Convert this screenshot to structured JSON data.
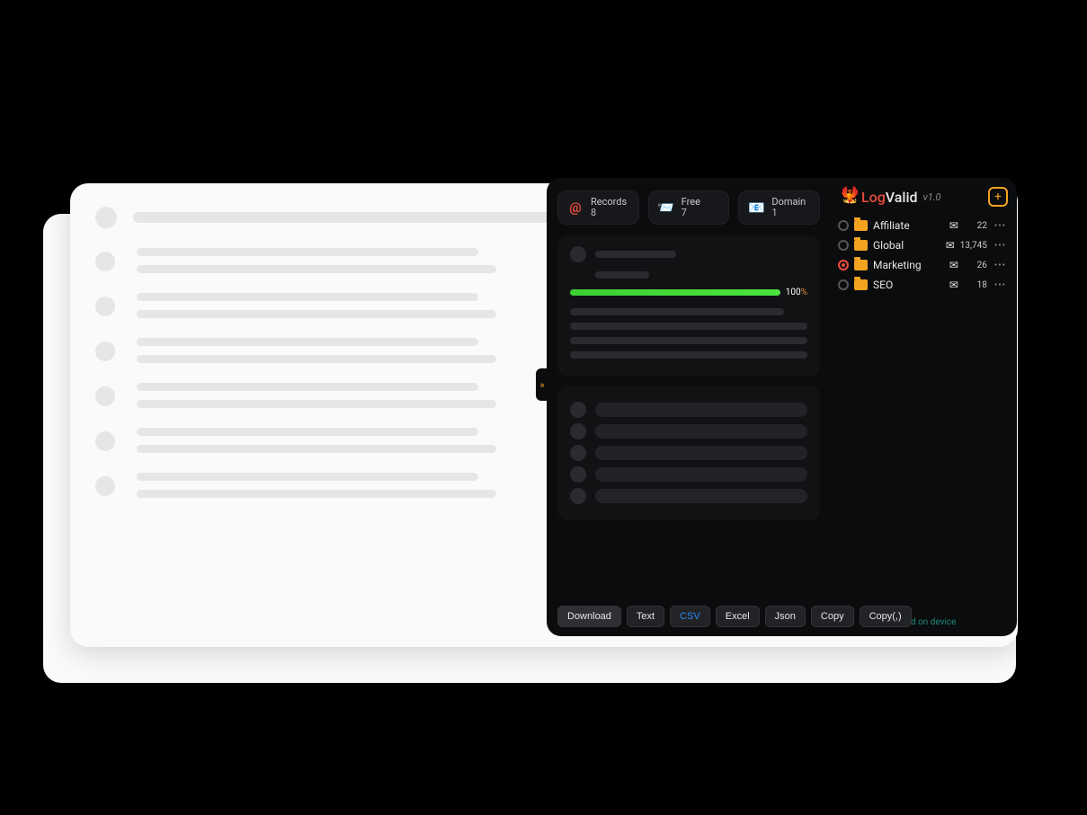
{
  "app": {
    "brand_log": "Log",
    "brand_valid": "Valid",
    "version": "v1.0"
  },
  "stats": {
    "records": {
      "label": "Records",
      "value": "8"
    },
    "free": {
      "label": "Free",
      "value": "7"
    },
    "domain": {
      "label": "Domain",
      "value": "1"
    }
  },
  "progress": {
    "value": "100",
    "suffix": "%"
  },
  "folders": [
    {
      "name": "Affiliate",
      "count": "22",
      "active": false
    },
    {
      "name": "Global",
      "count": "13,745",
      "active": false
    },
    {
      "name": "Marketing",
      "count": "26",
      "active": true
    },
    {
      "name": "SEO",
      "count": "18",
      "active": false
    }
  ],
  "export": {
    "download": "Download",
    "text": "Text",
    "csv": "CSV",
    "excel": "Excel",
    "json": "Json",
    "copy": "Copy",
    "copy_comma": "Copy(,)"
  },
  "footer": "Stored on device"
}
